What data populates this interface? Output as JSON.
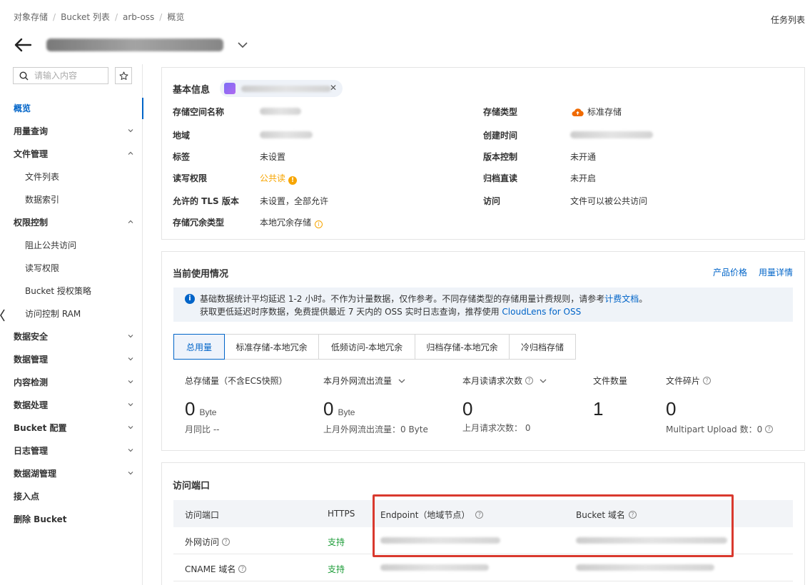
{
  "breadcrumb": [
    "对象存储",
    "Bucket 列表",
    "arb-oss",
    "概览"
  ],
  "task_list": "任务列表",
  "sidebar": {
    "search_placeholder": "请输入内容",
    "items": [
      {
        "label": "概览"
      },
      {
        "label": "用量查询"
      },
      {
        "label": "文件管理"
      },
      {
        "label": "文件列表"
      },
      {
        "label": "数据索引"
      },
      {
        "label": "权限控制"
      },
      {
        "label": "阻止公共访问"
      },
      {
        "label": "读写权限"
      },
      {
        "label": "Bucket 授权策略"
      },
      {
        "label": "访问控制 RAM"
      },
      {
        "label": "数据安全"
      },
      {
        "label": "数据管理"
      },
      {
        "label": "内容检测"
      },
      {
        "label": "数据处理"
      },
      {
        "label": "Bucket 配置"
      },
      {
        "label": "日志管理"
      },
      {
        "label": "数据湖管理"
      },
      {
        "label": "接入点"
      },
      {
        "label": "删除 Bucket"
      }
    ]
  },
  "basic": {
    "title": "基本信息",
    "bucket_name_label": "存储空间名称",
    "storage_type_label": "存储类型",
    "storage_type_value": "标准存储",
    "region_label": "地域",
    "created_label": "创建时间",
    "tags_label": "标签",
    "tags_value": "未设置",
    "versioning_label": "版本控制",
    "versioning_value": "未开通",
    "acl_label": "读写权限",
    "acl_value": "公共读",
    "archive_label": "归档直读",
    "archive_value": "未开启",
    "tls_label": "允许的 TLS 版本",
    "tls_value": "未设置，全部允许",
    "access_label": "访问",
    "access_value": "文件可以被公共访问",
    "redundancy_label": "存储冗余类型",
    "redundancy_value": "本地冗余存储"
  },
  "usage": {
    "title": "当前使用情况",
    "price_link": "产品价格",
    "detail_link": "用量详情",
    "notice_line1": "基础数据统计平均延迟 1-2 小时。不作为计量数据，仅作参考。不同存储类型的存储用量计费规则，请参考",
    "notice_link1": "计费文档",
    "notice_line1_end": "。",
    "notice_line2": "获取更低延迟时序数据，免费提供最近 7 天内的 OSS 实时日志查询，推荐使用",
    "notice_link2": "CloudLens for OSS",
    "tabs": [
      "总用量",
      "标准存储-本地冗余",
      "低频访问-本地冗余",
      "归档存储-本地冗余",
      "冷归档存储"
    ],
    "metrics": {
      "m1_label": "总存储量（不含ECS快照）",
      "m1_value": "0",
      "m1_unit": "Byte",
      "m1_sub": "月同比  --",
      "m2_label": "本月外网流出流量",
      "m2_value": "0",
      "m2_unit": "Byte",
      "m2_sub": "上月外网流出流量：0 Byte",
      "m3_label": "本月读请求次数",
      "m3_value": "0",
      "m3_sub": "上月请求次数：  0",
      "m4_label": "文件数量",
      "m4_value": "1",
      "m5_label": "文件碎片",
      "m5_value": "0",
      "m5_sub": "Multipart Upload 数：0"
    }
  },
  "endpoints": {
    "title": "访问端口",
    "columns": [
      "访问端口",
      "HTTPS",
      "Endpoint（地域节点）",
      "Bucket 域名"
    ],
    "rows": [
      {
        "port": "外网访问",
        "https": "支持"
      },
      {
        "port": "CNAME 域名",
        "https": "支持"
      }
    ]
  },
  "colors": {
    "brand": "#0064c8",
    "warning": "#f7a500",
    "success": "#1f9d3a",
    "highlight": "#d9392e"
  }
}
